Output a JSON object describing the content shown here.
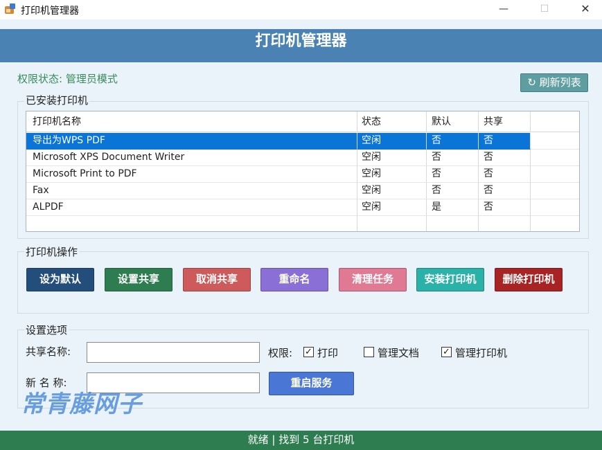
{
  "window": {
    "title": "打印机管理器",
    "minimize": "—",
    "maximize": "☐",
    "close": "✕"
  },
  "header": {
    "title": "打印机管理器"
  },
  "permission_status": "权限状态: 管理员模式",
  "refresh_button": "↻ 刷新列表",
  "installed": {
    "group_title": "已安装打印机",
    "columns": [
      "打印机名称",
      "状态",
      "默认",
      "共享"
    ],
    "rows": [
      [
        "导出为WPS PDF",
        "空闲",
        "否",
        "否"
      ],
      [
        "Microsoft XPS Document Writer",
        "空闲",
        "否",
        "否"
      ],
      [
        "Microsoft Print to PDF",
        "空闲",
        "否",
        "否"
      ],
      [
        "Fax",
        "空闲",
        "否",
        "否"
      ],
      [
        "ALPDF",
        "空闲",
        "是",
        "否"
      ]
    ],
    "selected_row": 0
  },
  "operations": {
    "group_title": "打印机操作",
    "buttons": [
      {
        "label": "设为默认",
        "color": "#234e7b"
      },
      {
        "label": "设置共享",
        "color": "#2e7d50"
      },
      {
        "label": "取消共享",
        "color": "#cd5b5b"
      },
      {
        "label": "重命名",
        "color": "#8a6fd6"
      },
      {
        "label": "清理任务",
        "color": "#e07a94"
      },
      {
        "label": "安装打印机",
        "color": "#2ab1a8"
      },
      {
        "label": "删除打印机",
        "color": "#a82323"
      }
    ]
  },
  "settings": {
    "group_title": "设置选项",
    "share_name_label": "共享名称:",
    "share_name_value": "",
    "new_name_label": "新 名 称:",
    "new_name_value": "",
    "permissions_label": "权限:",
    "permissions": [
      {
        "label": "打印",
        "checked": true
      },
      {
        "label": "管理文档",
        "checked": false
      },
      {
        "label": "管理打印机",
        "checked": true
      }
    ],
    "restart_button": "重启服务"
  },
  "watermark": "常青藤网子",
  "status_bar": "就绪 | 找到 5 台打印机"
}
